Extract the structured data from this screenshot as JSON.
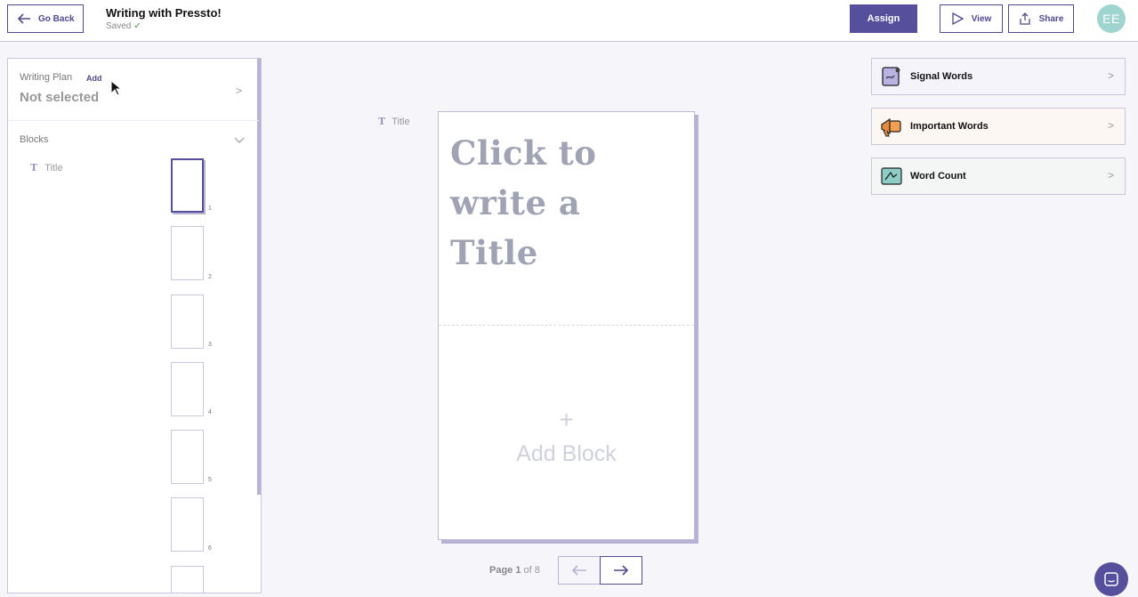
{
  "header": {
    "go_back": "Go Back",
    "title": "Writing with Pressto!",
    "status": "Saved",
    "assign": "Assign",
    "view": "View",
    "share": "Share",
    "avatar_initials": "EE"
  },
  "writing_plan": {
    "label": "Writing Plan",
    "add": "Add",
    "value": "Not selected"
  },
  "blocks": {
    "label": "Blocks",
    "items": [
      {
        "label": "Title",
        "icon": "T"
      }
    ],
    "thumbnails": [
      "1",
      "2",
      "3",
      "4",
      "5",
      "6"
    ]
  },
  "document": {
    "block_label": "Title",
    "block_icon": "T",
    "title_placeholder": "Click to write a Title",
    "add_block_plus": "+",
    "add_block": "Add Block"
  },
  "pager": {
    "page_word": "Page",
    "current": "1",
    "of_word": "of",
    "total": "8"
  },
  "tools": {
    "signal_words": "Signal Words",
    "important_words": "Important Words",
    "word_count": "Word Count"
  },
  "colors": {
    "accent": "#554f9c",
    "avatar": "#9fd4cf",
    "placeholder_text": "#9fa3b3"
  }
}
